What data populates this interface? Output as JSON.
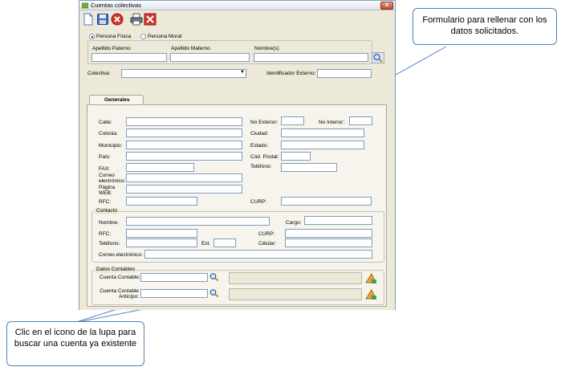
{
  "window": {
    "title": "Cuentas colectivas",
    "close_label": "X"
  },
  "toolbar": {
    "icons": [
      "new-document-icon",
      "save-disk-icon",
      "cancel-circle-icon",
      "print-icon",
      "exit-x-icon"
    ]
  },
  "person_type": {
    "fisica": "Persona Física",
    "moral": "Persona Moral",
    "selected": "fisica"
  },
  "name_fields": {
    "paterno": "Apellido Paterno",
    "materno": "Apellido Materno",
    "nombres": "Nombre(s)"
  },
  "colectiva": {
    "label": "Colectiva:",
    "ident_label": "Identificador Externo:"
  },
  "tab": {
    "generales": "Generales"
  },
  "generales": {
    "calle": "Calle:",
    "no_exterior": "No Exterior:",
    "no_interior": "No Interior:",
    "colonia": "Colonia:",
    "ciudad": "Ciudad:",
    "municipio": "Municipio:",
    "estado": "Estado:",
    "pais": "País:",
    "cod_postal": "Cód. Postal:",
    "fax": "FAX:",
    "telefono": "Teléfono:",
    "correo": "Correo electrónico:",
    "pagina": "Página WEB:",
    "rfc": "RFC:",
    "curp": "CURP:"
  },
  "contacto": {
    "title": "Contacto",
    "nombre": "Nombre:",
    "cargo": "Cargo:",
    "rfc": "RFC:",
    "curp": "CURP:",
    "telefono": "Teléfono:",
    "ext": "Ext.",
    "celular": "Célular:",
    "correo": "Correo electrónico:"
  },
  "datos_contables": {
    "title": "Datos Contables",
    "cuenta": "Cuenta Contable:",
    "anticipo": "Cuenta Contable Anticipo:"
  },
  "callouts": {
    "form": "Formulario para rellenar con los datos solicitados.",
    "search": "Clic en el icono de la lupa para buscar una cuenta ya existente"
  },
  "colors": {
    "callout_border": "#4f81bd",
    "window_bg": "#ece9d8",
    "input_border": "#7f9db9"
  }
}
